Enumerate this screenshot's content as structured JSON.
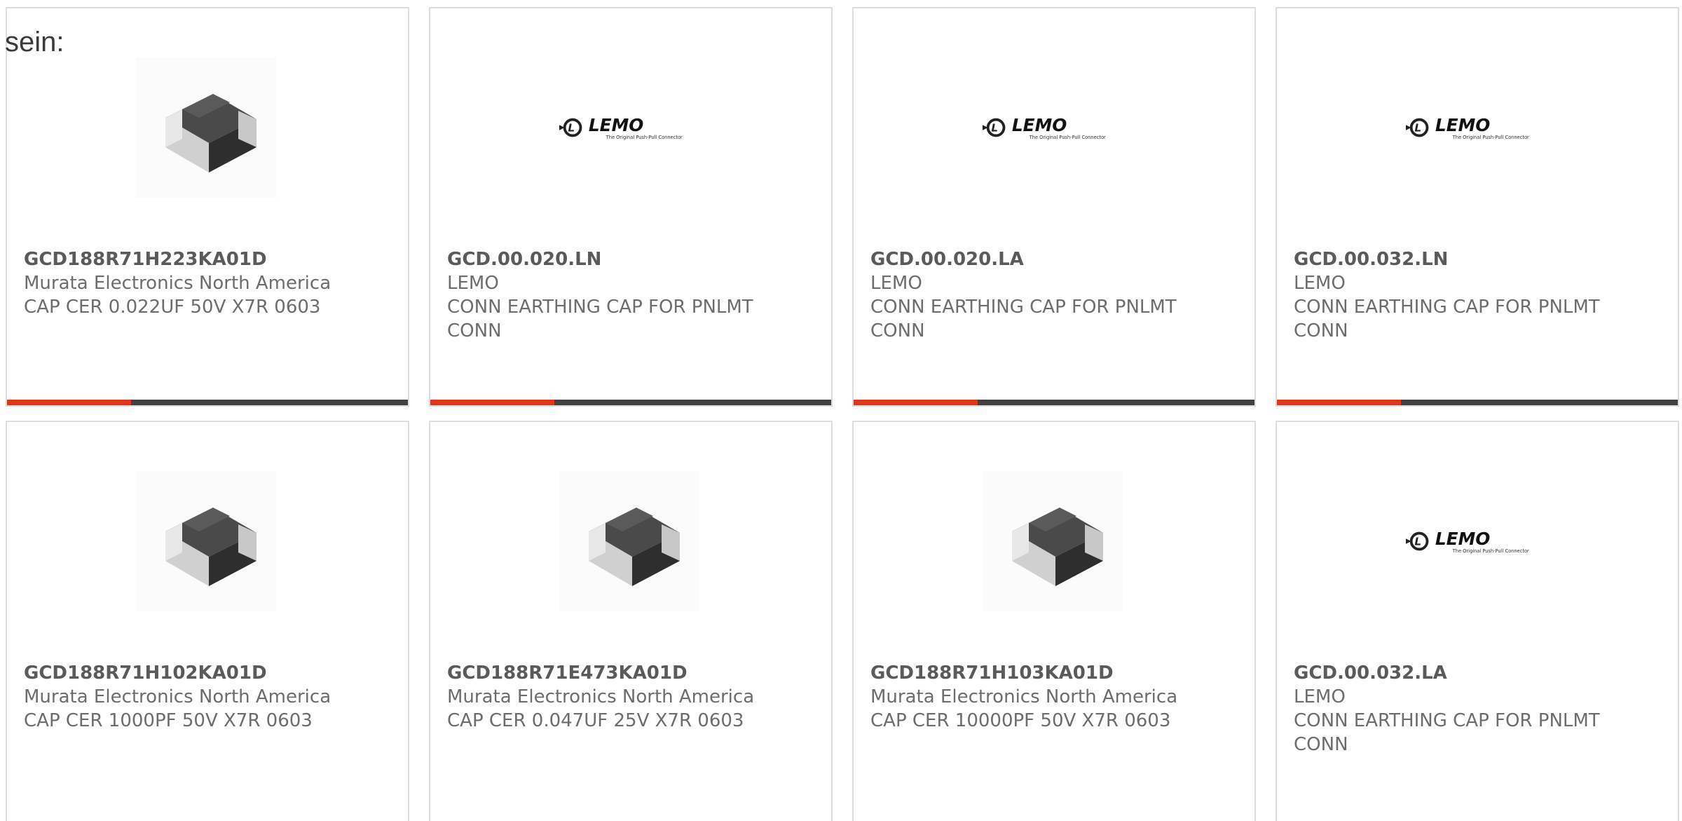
{
  "intro_text": "sein:",
  "colors": {
    "accent": "#e0351b",
    "track": "#404040",
    "border": "#dddddd",
    "text": "#6d6d6d"
  },
  "cards": [
    {
      "part_number": "GCD188R71H223KA01D",
      "manufacturer": "Murata Electronics North America",
      "description": "CAP CER 0.022UF 50V X7R 0603",
      "image": "chip-capacitor-image",
      "progress": 0.31
    },
    {
      "part_number": "GCD.00.020.LN",
      "manufacturer": "LEMO",
      "description": "CONN EARTHING CAP FOR PNLMT CONN",
      "image": "lemo-logo-image",
      "logo_text": "LEMO",
      "logo_tagline": "The Original Push-Pull Connector",
      "progress": 0.31
    },
    {
      "part_number": "GCD.00.020.LA",
      "manufacturer": "LEMO",
      "description": "CONN EARTHING CAP FOR PNLMT CONN",
      "image": "lemo-logo-image",
      "logo_text": "LEMO",
      "logo_tagline": "The Original Push-Pull Connector",
      "progress": 0.31
    },
    {
      "part_number": "GCD.00.032.LN",
      "manufacturer": "LEMO",
      "description": "CONN EARTHING CAP FOR PNLMT CONN",
      "image": "lemo-logo-image",
      "logo_text": "LEMO",
      "logo_tagline": "The Original Push-Pull Connector",
      "progress": 0.31
    },
    {
      "part_number": "GCD188R71H102KA01D",
      "manufacturer": "Murata Electronics North America",
      "description": "CAP CER 1000PF 50V X7R 0603",
      "image": "chip-capacitor-image"
    },
    {
      "part_number": "GCD188R71E473KA01D",
      "manufacturer": "Murata Electronics North America",
      "description": "CAP CER 0.047UF 25V X7R 0603",
      "image": "chip-capacitor-image"
    },
    {
      "part_number": "GCD188R71H103KA01D",
      "manufacturer": "Murata Electronics North America",
      "description": "CAP CER 10000PF 50V X7R 0603",
      "image": "chip-capacitor-image"
    },
    {
      "part_number": "GCD.00.032.LA",
      "manufacturer": "LEMO",
      "description": "CONN EARTHING CAP FOR PNLMT CONN",
      "image": "lemo-logo-image",
      "logo_text": "LEMO",
      "logo_tagline": "The Original Push-Pull Connector"
    }
  ]
}
